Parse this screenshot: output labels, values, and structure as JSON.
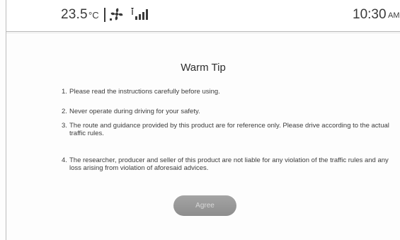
{
  "status_bar": {
    "temperature": "23.5",
    "temperature_unit": "°C",
    "fan_icon": "fan-icon",
    "signal_icon": "cellular-signal-icon",
    "time": "10:30",
    "ampm": "AM"
  },
  "dialog": {
    "title": "Warm Tip",
    "tips": [
      {
        "number": "1.",
        "text": "Please read the instructions carefully before using."
      },
      {
        "number": "2.",
        "text": "Never operate during driving for your safety."
      },
      {
        "number": "3.",
        "text": "The route and guidance provided by this product are for reference only. Please drive according to the actual traffic rules."
      },
      {
        "number": "4.",
        "text": "The researcher, producer and seller of this product are not liable for any violation of the traffic rules and any loss arising from violation of aforesaid advices."
      }
    ],
    "agree_label": "Agree"
  },
  "colors": {
    "background": "#fdfdfd",
    "text": "#3c3c3c",
    "button": "#979797",
    "button_text": "#d8d8d8",
    "divider": "#b8b8b8"
  }
}
